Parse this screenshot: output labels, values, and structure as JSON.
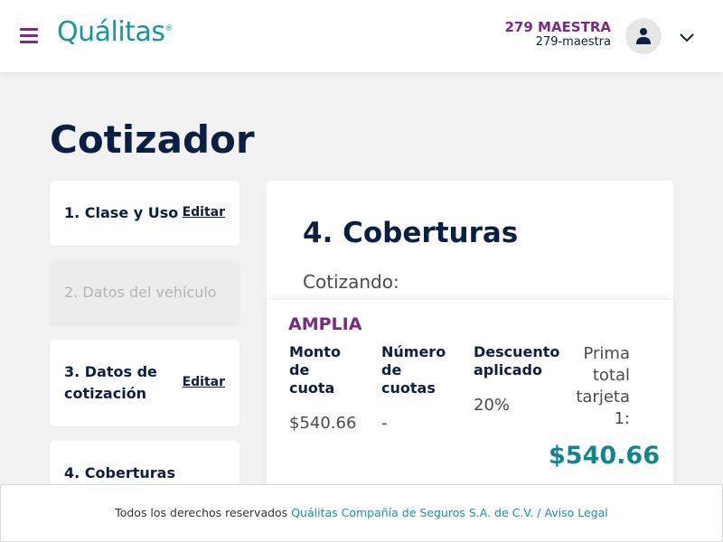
{
  "header": {
    "logo_text": "Quálitas",
    "logo_mark": "®",
    "user_display": "279 MAESTRA",
    "user_id": "279-maestra"
  },
  "page": {
    "title": "Cotizador"
  },
  "steps": [
    {
      "label": "1. Clase y Uso",
      "edit": "Editar"
    },
    {
      "label": "2. Datos del vehículo"
    },
    {
      "label": "3. Datos de cotización",
      "edit": "Editar"
    },
    {
      "label": "4. Coberturas"
    }
  ],
  "main": {
    "title": "4. Coberturas",
    "subtitle": "Cotizando:"
  },
  "quote": {
    "plan": "AMPLIA",
    "monto_header": "Monto de cuota",
    "monto_value": "$540.66",
    "cuotas_header": "Número de cuotas",
    "cuotas_value": "-",
    "descuento_header": "Descuento aplicado",
    "descuento_value": "20%",
    "total_label": "Prima total tarjeta 1:",
    "total_value": "$540.66"
  },
  "footer": {
    "text": "Todos los derechos reservados",
    "link1": "Quálitas Compañía de Seguros S.A. de C.V.",
    "separator": "/",
    "link2": "Aviso Legal"
  },
  "colors": {
    "brand_purple": "#7a2a82",
    "brand_teal": "#1595a3",
    "navy": "#0a1f44"
  },
  "icons": {
    "menu": "hamburger-menu-icon",
    "avatar": "user-icon",
    "dropdown": "chevron-down-icon"
  }
}
